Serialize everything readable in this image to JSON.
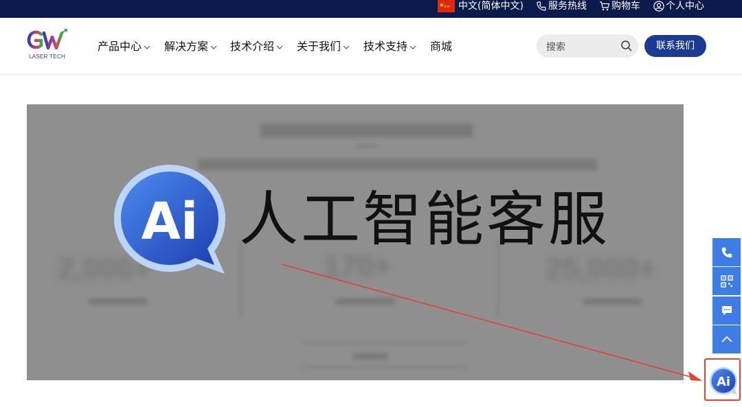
{
  "topbar": {
    "language": "中文(简体中文)",
    "hotline": "服务热线",
    "cart": "购物车",
    "account": "个人中心"
  },
  "header": {
    "logo_text": "LASER TECH",
    "nav": [
      {
        "label": "产品中心",
        "has_dropdown": true
      },
      {
        "label": "解决方案",
        "has_dropdown": true
      },
      {
        "label": "技术介绍",
        "has_dropdown": true
      },
      {
        "label": "关于我们",
        "has_dropdown": true
      },
      {
        "label": "技术支持",
        "has_dropdown": true
      },
      {
        "label": "商城",
        "has_dropdown": false
      }
    ],
    "search_placeholder": "搜索",
    "contact_button": "联系我们"
  },
  "banner": {
    "ai_logo_text": "Ai",
    "title": "人工智能客服",
    "stats_blurred": [
      "2,000+",
      "170+",
      "25,000+"
    ]
  },
  "side_tools": {
    "buttons": [
      "phone-icon",
      "qr-code-icon",
      "chat-icon",
      "back-to-top-icon"
    ],
    "ai_button_text": "Ai"
  },
  "colors": {
    "topbar_bg": "#0b1a4a",
    "brand_blue": "#1a3a93",
    "side_blue": "#3f7de6",
    "highlight_red": "#e8412c"
  }
}
